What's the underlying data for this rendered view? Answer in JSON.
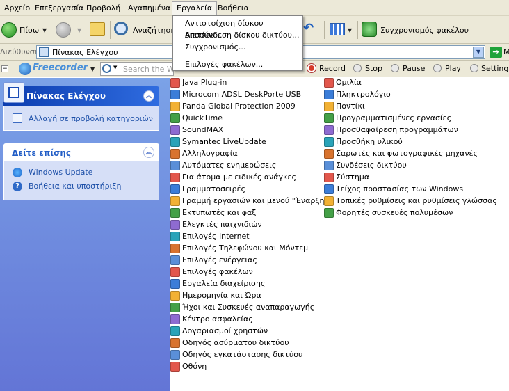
{
  "menu_bar": {
    "items": [
      "Αρχείο",
      "Επεξεργασία",
      "Προβολή",
      "Αγαπημένα",
      "Εργαλεία",
      "Βοήθεια"
    ]
  },
  "tools_menu": {
    "items": [
      "Αντιστοίχιση δίσκου δικτύου...",
      "Αποσύνδεση δίσκου δικτύου...",
      "Συγχρονισμός...",
      "Επιλογές φακέλων..."
    ]
  },
  "toolbar": {
    "back_label": "Πίσω",
    "search_label": "Αναζήτηση",
    "sync_label": "Συγχρονισμός φακέλου"
  },
  "address_bar": {
    "label": "Διεύθυνση",
    "value": "Πίνακας Ελέγχου",
    "go_label": "Μ"
  },
  "freecorder": {
    "logo": "Freecorder",
    "search_placeholder": "Search the Web",
    "buttons": [
      "Record",
      "Stop",
      "Pause",
      "Play",
      "Settings"
    ]
  },
  "left_pane": {
    "control_panel": {
      "title": "Πίνακας Ελέγχου",
      "link": "Αλλαγή σε προβολή κατηγοριών"
    },
    "see_also": {
      "title": "Δείτε επίσης",
      "links": [
        "Windows Update",
        "Βοήθεια και υποστήριξη"
      ]
    }
  },
  "file_list": {
    "col1": [
      "Java Plug-in",
      "Microcom ADSL DeskPorte USB",
      "Panda Global Protection 2009",
      "QuickTime",
      "SoundMAX",
      "Symantec LiveUpdate",
      "Αλληλογραφία",
      "Αυτόματες ενημερώσεις",
      "Για άτομα με ειδικές ανάγκες",
      "Γραμματοσειρές",
      "Γραμμή εργασιών και μενού \"Έναρξη\"",
      "Εκτυπωτές και φαξ",
      "Ελεγκτές παιχνιδιών",
      "Επιλογές Internet",
      "Επιλογές Τηλεφώνου και Μόντεμ",
      "Επιλογές ενέργειας",
      "Επιλογές φακέλων",
      "Εργαλεία διαχείρισης",
      "Ημερομηνία και Ώρα",
      "Ήχοι και Συσκευές αναπαραγωγής",
      "Κέντρο ασφαλείας",
      "Λογαριασμοί χρηστών",
      "Οδηγός ασύρματου δικτύου",
      "Οδηγός εγκατάστασης δικτύου",
      "Οθόνη"
    ],
    "col2": [
      "Ομιλία",
      "Πληκτρολόγιο",
      "Ποντίκι",
      "Προγραμματισμένες εργασίες",
      "Προσθαφαίρεση προγραμμάτων",
      "Προσθήκη υλικού",
      "Σαρωτές και φωτογραφικές μηχανές",
      "Συνδέσεις δικτύου",
      "Σύστημα",
      "Τείχος προστασίας των Windows",
      "Τοπικές ρυθμίσεις και ρυθμίσεις γλώσσας",
      "Φορητές συσκευές πολυμέσων"
    ]
  },
  "colors": {
    "xp_blue": "#7ba2e7",
    "panel_header": "#215dc6",
    "menu_bg": "#ece9d8",
    "link_blue": "#1c4fa8"
  }
}
